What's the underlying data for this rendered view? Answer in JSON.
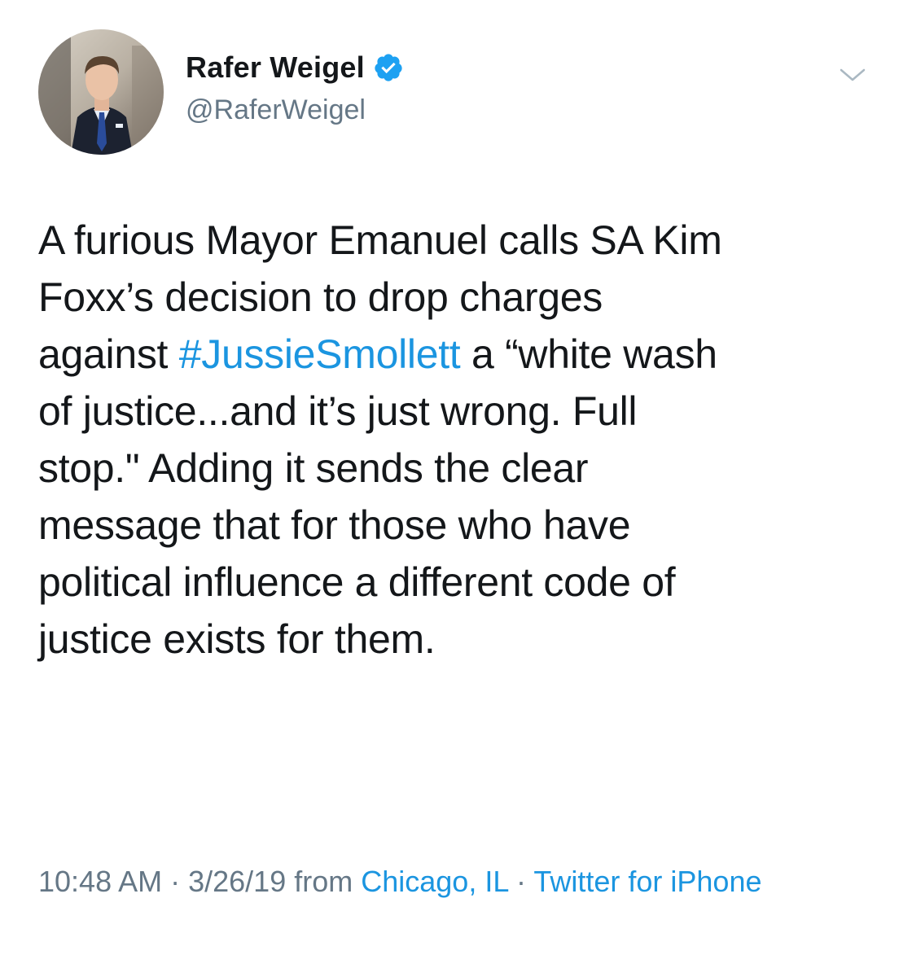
{
  "author": {
    "display_name": "Rafer Weigel",
    "handle": "@RaferWeigel",
    "verified": true,
    "avatar_icon": "profile-photo"
  },
  "menu": {
    "icon": "chevron-down-icon"
  },
  "tweet": {
    "lines": [
      "A furious Mayor Emanuel calls SA Kim",
      "Foxx’s decision to drop charges",
      "against ",
      "of justice...and it’s just wrong. Full",
      "stop.\" Adding it sends the clear",
      "message that for those who have",
      "political influence a different code of",
      "justice exists for them."
    ],
    "hashtag": "#JussieSmollett",
    "line3_after_hashtag": " a “white wash"
  },
  "meta": {
    "time": "10:48 AM",
    "separator": " · ",
    "date": "3/26/19",
    "from_label": " from ",
    "location": "Chicago, IL",
    "source": "Twitter for iPhone"
  },
  "colors": {
    "link": "#1b95e0",
    "verified_badge": "#1da1f2",
    "secondary_text": "#657786",
    "primary_text": "#14171a"
  }
}
